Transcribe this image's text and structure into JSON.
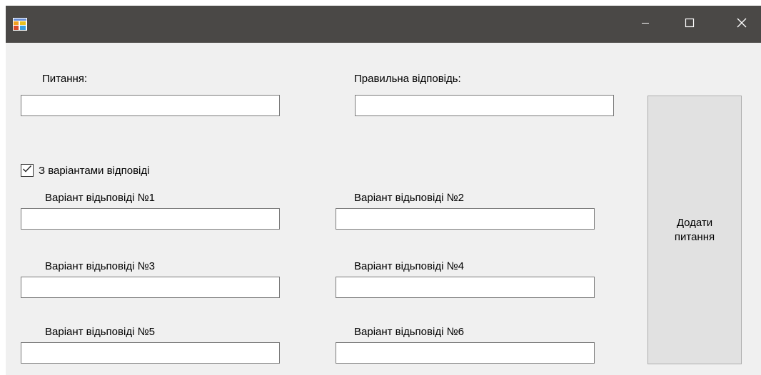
{
  "window": {
    "icon": "form-app-icon",
    "controls": {
      "minimize_icon": "minimize-icon",
      "maximize_icon": "maximize-icon",
      "close_icon": "close-icon"
    }
  },
  "form": {
    "question_label": "Питання:",
    "question_value": "",
    "correct_answer_label": "Правильна відповідь:",
    "correct_answer_value": "",
    "multiple_choice_checkbox": {
      "label": "З варіантами відповіді",
      "checked": true
    },
    "variants": [
      {
        "label": "Варіант відьповіді №1",
        "value": ""
      },
      {
        "label": "Варіант відьповіді №2",
        "value": ""
      },
      {
        "label": "Варіант відьповіді №3",
        "value": ""
      },
      {
        "label": "Варіант відьповіді №4",
        "value": ""
      },
      {
        "label": "Варіант відьповіді №5",
        "value": ""
      },
      {
        "label": "Варіант відьповіді №6",
        "value": ""
      }
    ],
    "add_button_label": "Додати\nпитання"
  },
  "colors": {
    "titlebar": "#4a4846",
    "window_bg": "#f0f0f0",
    "button_bg": "#e1e1e1"
  }
}
